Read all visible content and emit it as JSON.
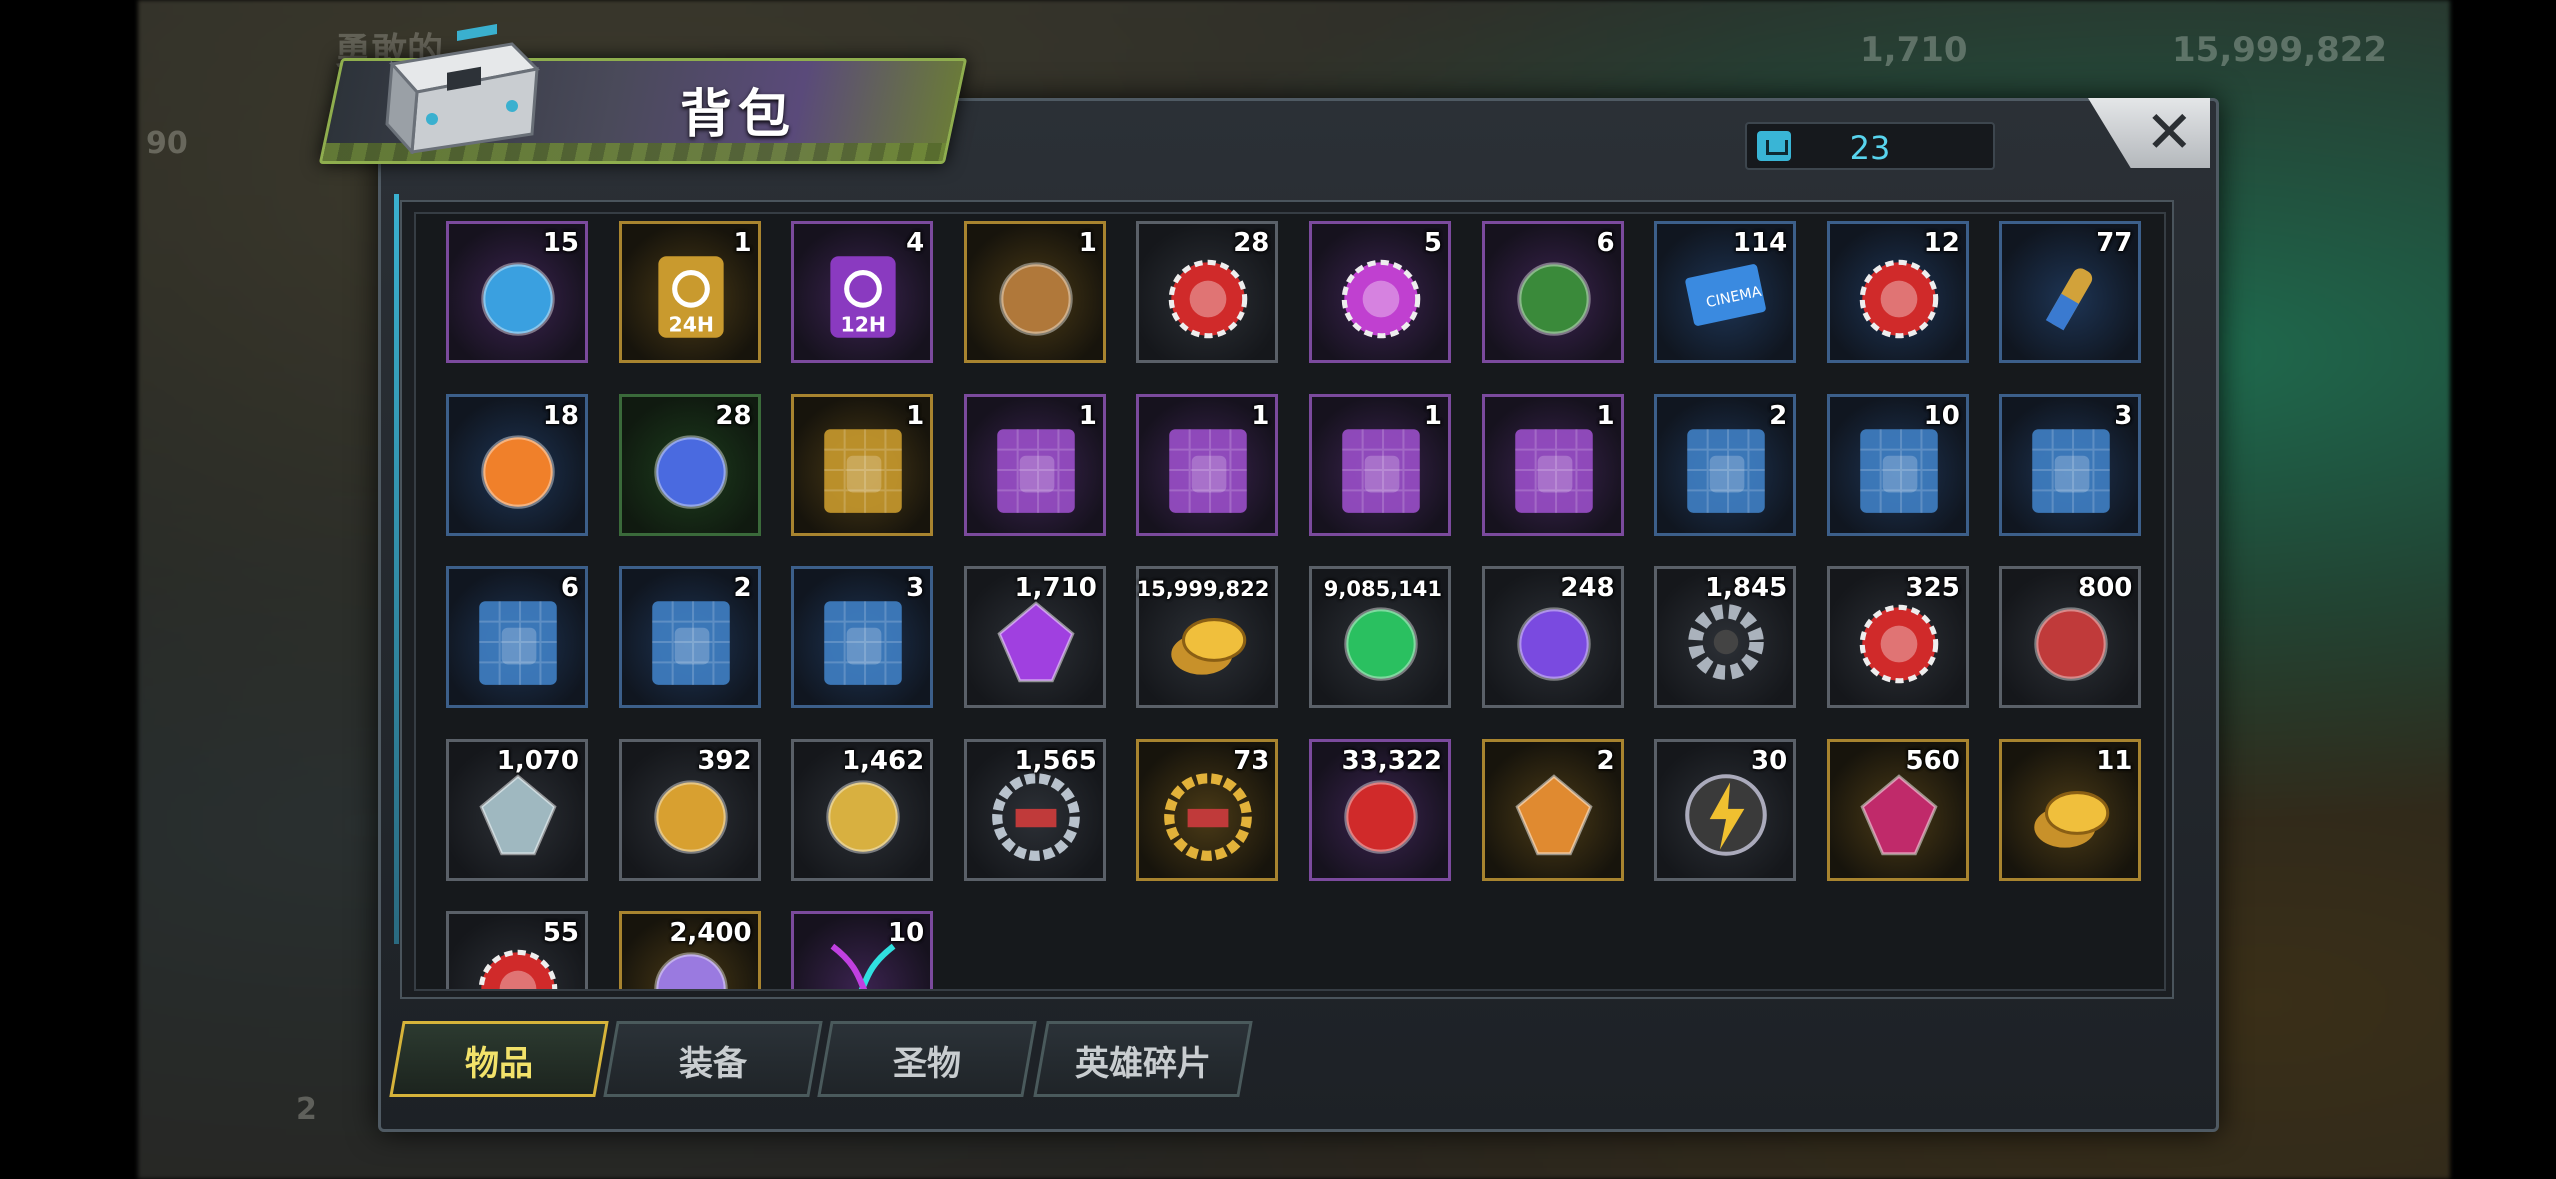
{
  "header": {
    "title": "背包"
  },
  "capacity": {
    "value": "23",
    "icon": "backpack-icon"
  },
  "background_hud": {
    "title": "勇敢的",
    "level": "90",
    "resource_1": "1,710",
    "resource_2": "15,999,822",
    "count": "2"
  },
  "items": [
    {
      "qty": "15",
      "icon": "hammer-upgrade-icon",
      "rarity": "purple"
    },
    {
      "qty": "1",
      "icon": "speedup-24h-icon",
      "rarity": "gold"
    },
    {
      "qty": "4",
      "icon": "speedup-12h-icon",
      "rarity": "purple"
    },
    {
      "qty": "1",
      "icon": "mystery-cube-icon",
      "rarity": "gold"
    },
    {
      "qty": "28",
      "icon": "red-bottlecap-icon",
      "rarity": "grey"
    },
    {
      "qty": "5",
      "icon": "purple-bottlecap-icon",
      "rarity": "purple"
    },
    {
      "qty": "6",
      "icon": "owl-plush-icon",
      "rarity": "purple"
    },
    {
      "qty": "114",
      "icon": "cinema-ticket-icon",
      "rarity": "blue"
    },
    {
      "qty": "12",
      "icon": "poker-chip-icon",
      "rarity": "blue"
    },
    {
      "qty": "77",
      "icon": "bullet-icon",
      "rarity": "blue"
    },
    {
      "qty": "18",
      "icon": "fire-spirit-icon",
      "rarity": "blue"
    },
    {
      "qty": "28",
      "icon": "blue-glove-icon",
      "rarity": "green"
    },
    {
      "qty": "1",
      "icon": "blueprint-boots-gold-icon",
      "rarity": "gold"
    },
    {
      "qty": "1",
      "icon": "blueprint-swords-purple-icon",
      "rarity": "purple"
    },
    {
      "qty": "1",
      "icon": "blueprint-hat-purple-icon",
      "rarity": "purple"
    },
    {
      "qty": "1",
      "icon": "blueprint-boots-purple-icon",
      "rarity": "purple"
    },
    {
      "qty": "1",
      "icon": "blueprint-pistol-purple-icon",
      "rarity": "purple"
    },
    {
      "qty": "2",
      "icon": "blueprint-boots-blue-icon",
      "rarity": "blue"
    },
    {
      "qty": "10",
      "icon": "blueprint-swords-blue-icon",
      "rarity": "blue"
    },
    {
      "qty": "3",
      "icon": "blueprint-necklace-blue-icon",
      "rarity": "blue"
    },
    {
      "qty": "6",
      "icon": "blueprint-pistol-blue-icon",
      "rarity": "blue"
    },
    {
      "qty": "2",
      "icon": "blueprint-hat-blue-icon",
      "rarity": "blue"
    },
    {
      "qty": "3",
      "icon": "blueprint-shirt-blue-icon",
      "rarity": "blue"
    },
    {
      "qty": "1,710",
      "icon": "purple-gem-icon",
      "rarity": "grey"
    },
    {
      "qty": "15,999,822",
      "icon": "gold-coins-icon",
      "rarity": "grey"
    },
    {
      "qty": "9,085,141",
      "icon": "green-fuel-canister-icon",
      "rarity": "grey"
    },
    {
      "qty": "248",
      "icon": "purple-core-icon",
      "rarity": "grey"
    },
    {
      "qty": "1,845",
      "icon": "gear-icon",
      "rarity": "grey"
    },
    {
      "qty": "325",
      "icon": "red-network-token-icon",
      "rarity": "grey"
    },
    {
      "qty": "800",
      "icon": "eye-card-icon",
      "rarity": "grey"
    },
    {
      "qty": "1,070",
      "icon": "crystal-prism-icon",
      "rarity": "grey"
    },
    {
      "qty": "392",
      "icon": "golden-fist-icon",
      "rarity": "grey"
    },
    {
      "qty": "1,462",
      "icon": "puzzle-piece-icon",
      "rarity": "grey"
    },
    {
      "qty": "1,565",
      "icon": "ship-medal-silver-icon",
      "rarity": "grey"
    },
    {
      "qty": "73",
      "icon": "ship-medal-gold-icon",
      "rarity": "gold"
    },
    {
      "qty": "33,322",
      "icon": "red-hex-token-icon",
      "rarity": "purple"
    },
    {
      "qty": "2",
      "icon": "orange-prism-icon",
      "rarity": "gold"
    },
    {
      "qty": "30",
      "icon": "lightning-coin-icon",
      "rarity": "grey"
    },
    {
      "qty": "560",
      "icon": "ruby-ore-icon",
      "rarity": "gold"
    },
    {
      "qty": "11",
      "icon": "gold-coin-stack-icon",
      "rarity": "gold"
    },
    {
      "qty": "55",
      "icon": "red-target-icon",
      "rarity": "grey"
    },
    {
      "qty": "2,400",
      "icon": "silver-orb-icon",
      "rarity": "gold"
    },
    {
      "qty": "10",
      "icon": "dna-helix-icon",
      "rarity": "purple"
    }
  ],
  "tabs": [
    {
      "label": "物品",
      "active": true
    },
    {
      "label": "装备",
      "active": false
    },
    {
      "label": "圣物",
      "active": false
    },
    {
      "label": "英雄碎片",
      "active": false
    }
  ],
  "colors": {
    "accent_cyan": "#58d4ee",
    "tab_active": "#f2e26a",
    "rarity_purple": "#7b4a9d",
    "rarity_gold": "#a8842f",
    "rarity_blue": "#3c5f8a",
    "rarity_green": "#3a6a3a",
    "rarity_grey": "#5a6068"
  }
}
